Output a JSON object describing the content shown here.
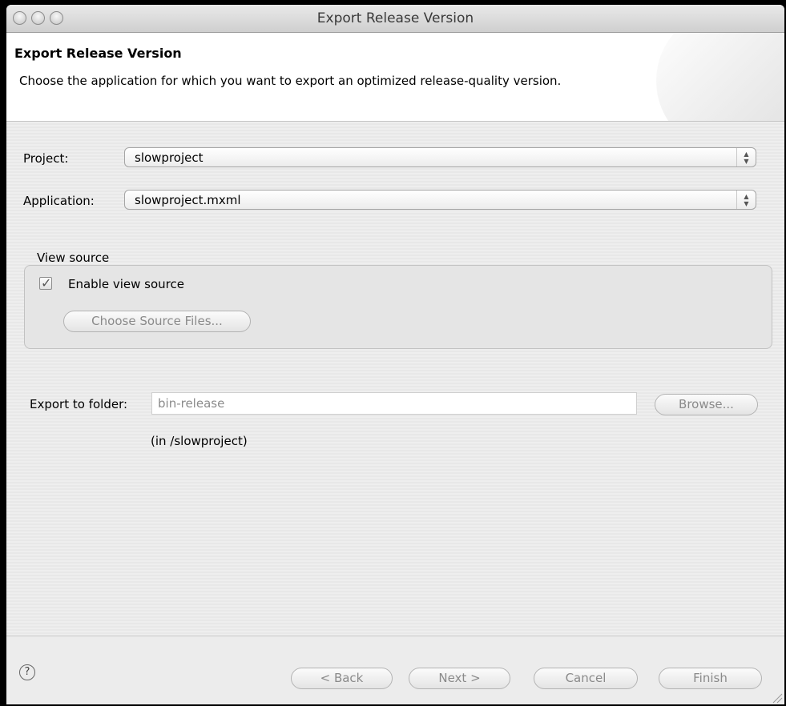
{
  "window": {
    "title": "Export Release Version"
  },
  "header": {
    "title": "Export Release Version",
    "description": "Choose the application for which you want to export an optimized release-quality version."
  },
  "form": {
    "project_label": "Project:",
    "project_value": "slowproject",
    "application_label": "Application:",
    "application_value": "slowproject.mxml",
    "view_source": {
      "group_label": "View source",
      "enable_label": "Enable view source",
      "enabled": true,
      "choose_button": "Choose Source Files..."
    },
    "export_label": "Export to folder:",
    "export_placeholder": "bin-release",
    "export_note": "(in /slowproject)",
    "browse_button": "Browse..."
  },
  "footer": {
    "help_icon": "?",
    "back_button": "< Back",
    "next_button": "Next >",
    "cancel_button": "Cancel",
    "finish_button": "Finish"
  },
  "icons": {
    "check": "✓",
    "combo_arrows": "▲▼"
  }
}
